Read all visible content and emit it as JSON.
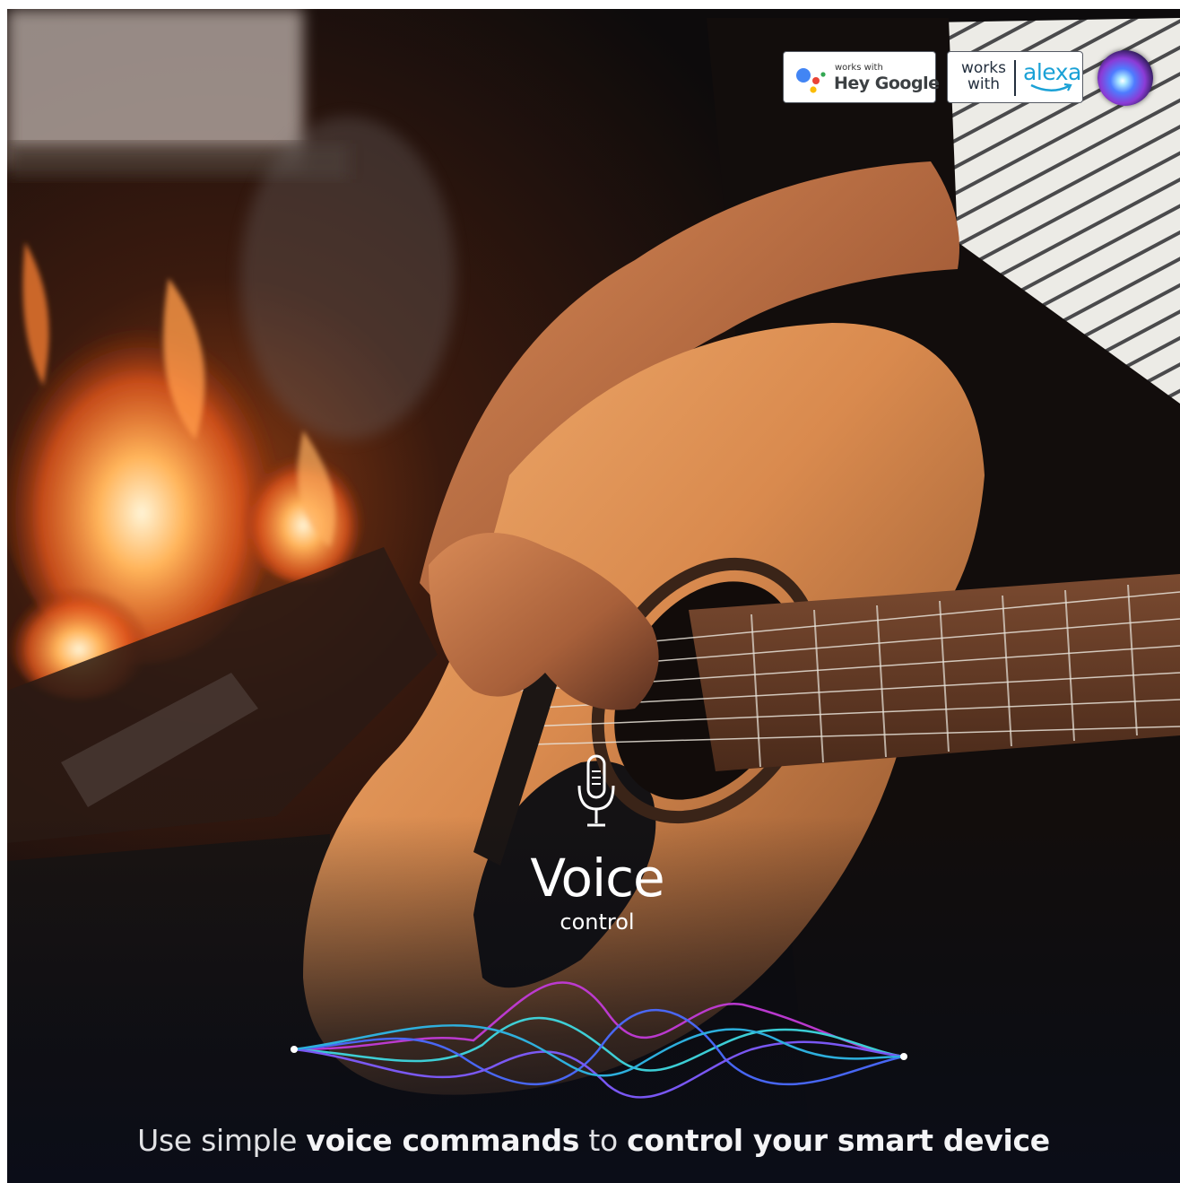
{
  "badges": {
    "google": {
      "small_text": "works with",
      "main_text": "Hey Google"
    },
    "alexa": {
      "works_text": "works with",
      "brand_text": "alexa"
    }
  },
  "hero": {
    "title": "Voice",
    "subtitle": "control"
  },
  "tagline": {
    "part1": "Use simple ",
    "part2": "voice commands",
    "part3": " to ",
    "part4": "control your smart device"
  },
  "icons": [
    "google-assistant-icon",
    "alexa-smile-icon",
    "siri-orb-icon",
    "microphone-icon",
    "sound-wave-icon"
  ],
  "colors": {
    "alexa_blue": "#1aa1d6",
    "wave_magenta": "#c23bd8",
    "wave_cyan": "#3fd8e0",
    "wave_blue": "#4b6bff",
    "background": "#0b0d14"
  }
}
